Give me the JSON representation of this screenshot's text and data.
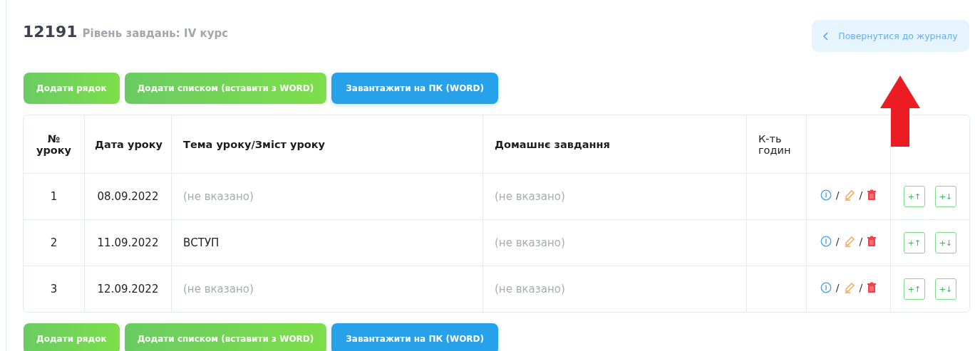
{
  "header": {
    "number": "12191",
    "subtitle": "Рівень завдань: IV курс",
    "back_button": "Повернутися до журналу"
  },
  "toolbar_top": [
    {
      "label": "Додати рядок",
      "kind": "green"
    },
    {
      "label": "Додати списком (вставити з WORD)",
      "kind": "green"
    },
    {
      "label": "Завантажити на ПК (WORD)",
      "kind": "blue"
    }
  ],
  "table": {
    "columns": [
      "№ уроку",
      "Дата уроку",
      "Тема уроку/Зміст уроку",
      "Домашнє завдання",
      "К-ть годин"
    ],
    "rows": [
      {
        "cells": [
          {
            "text": "1",
            "missing": false
          },
          {
            "text": "08.09.2022",
            "missing": false
          },
          {
            "text": "(не вказано)",
            "missing": true
          },
          {
            "text": "(не вказано)",
            "missing": true
          }
        ],
        "actions": [
          {
            "kind": "info"
          },
          {
            "kind": "separator",
            "text": "/"
          },
          {
            "kind": "edit"
          },
          {
            "kind": "separator",
            "text": "/"
          },
          {
            "kind": "delete"
          }
        ],
        "insert_buttons": [
          "+↑",
          "+↓"
        ]
      },
      {
        "cells": [
          {
            "text": "2",
            "missing": false
          },
          {
            "text": "11.09.2022",
            "missing": false
          },
          {
            "text": "ВСТУП",
            "missing": false
          },
          {
            "text": "(не вказано)",
            "missing": true
          }
        ],
        "actions": [
          {
            "kind": "info"
          },
          {
            "kind": "separator",
            "text": "/"
          },
          {
            "kind": "edit"
          },
          {
            "kind": "separator",
            "text": "/"
          },
          {
            "kind": "delete"
          }
        ],
        "insert_buttons": [
          "+↑",
          "+↓"
        ]
      },
      {
        "cells": [
          {
            "text": "3",
            "missing": false
          },
          {
            "text": "12.09.2022",
            "missing": false
          },
          {
            "text": "(не вказано)",
            "missing": true
          },
          {
            "text": "(не вказано)",
            "missing": true
          }
        ],
        "actions": [
          {
            "kind": "info"
          },
          {
            "kind": "separator",
            "text": "/"
          },
          {
            "kind": "edit"
          },
          {
            "kind": "separator",
            "text": "/"
          },
          {
            "kind": "delete"
          }
        ],
        "insert_buttons": [
          "+↑",
          "+↓"
        ]
      }
    ]
  },
  "toolbar_bottom": [
    {
      "label": "Додати рядок",
      "kind": "green"
    },
    {
      "label": "Додати списком (вставити з WORD)",
      "kind": "green"
    },
    {
      "label": "Завантажити на ПК (WORD)",
      "kind": "blue"
    }
  ],
  "annotation": {
    "kind": "arrow"
  }
}
